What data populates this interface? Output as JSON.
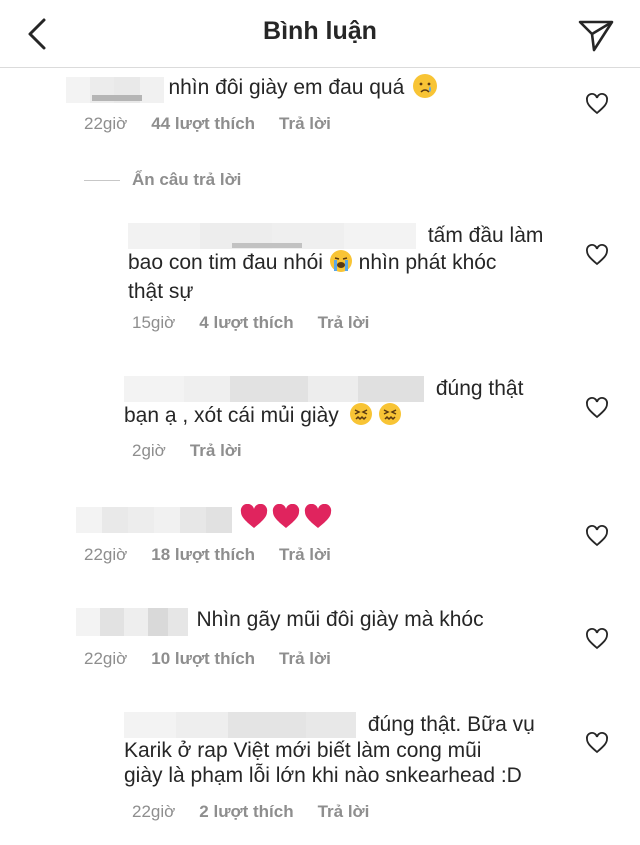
{
  "header": {
    "title": "Bình luận"
  },
  "hide_replies": "Ẩn câu trả lời",
  "comments": [
    {
      "text": "nhìn đôi giày em đau quá",
      "time": "22giờ",
      "likes": "44 lượt thích",
      "reply": "Trả lời"
    },
    {
      "text1": "tấm đầu làm",
      "text2a": "bao con tim đau nhói",
      "text2b": "nhìn phát khóc",
      "text3": "thật sự",
      "time": "15giờ",
      "likes": "4 lượt thích",
      "reply": "Trả lời"
    },
    {
      "text1": "đúng thật",
      "text2": "bạn ạ , xót cái mủi giày",
      "time": "2giờ",
      "reply": "Trả lời"
    },
    {
      "time": "22giờ",
      "likes": "18 lượt thích",
      "reply": "Trả lời"
    },
    {
      "text": "Nhìn gãy mũi đôi giày mà khóc",
      "time": "22giờ",
      "likes": "10 lượt thích",
      "reply": "Trả lời"
    },
    {
      "text1": "đúng thật. Bữa vụ",
      "text2": "Karik ở rap Việt mới biết làm cong mũi",
      "text3": "giày là phạm lỗi lớn khi nào snkearhead :D",
      "time": "22giờ",
      "likes": "2 lượt thích",
      "reply": "Trả lời"
    }
  ],
  "colors": {
    "text": "#262626",
    "muted": "#8e8e8e",
    "divider": "#dbdbdb",
    "heart_red": "#e0245e"
  }
}
